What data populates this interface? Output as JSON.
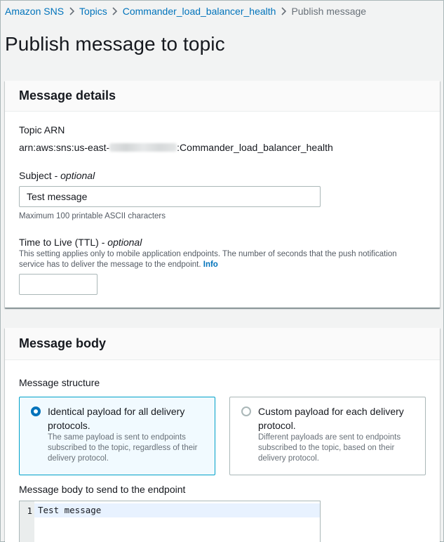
{
  "breadcrumb": {
    "items": [
      "Amazon SNS",
      "Topics",
      "Commander_load_balancer_health"
    ],
    "current": "Publish message"
  },
  "page_title": "Publish message to topic",
  "message_details": {
    "header": "Message details",
    "topic_arn_label": "Topic ARN",
    "topic_arn_prefix": "arn:aws:sns:us-east-",
    "topic_arn_suffix": ":Commander_load_balancer_health",
    "subject_label": "Subject - ",
    "subject_optional": "optional",
    "subject_value": "Test message",
    "subject_hint": "Maximum 100 printable ASCII characters",
    "ttl_label": "Time to Live (TTL) - ",
    "ttl_optional": "optional",
    "ttl_desc": "This setting applies only to mobile application endpoints. The number of seconds that the push notification service has to deliver the message to the endpoint.",
    "ttl_info": "Info",
    "ttl_value": ""
  },
  "message_body": {
    "header": "Message body",
    "structure_label": "Message structure",
    "options": [
      {
        "title": "Identical payload for all delivery protocols.",
        "desc": "The same payload is sent to endpoints subscribed to the topic, regardless of their delivery protocol.",
        "selected": true
      },
      {
        "title": "Custom payload for each delivery protocol.",
        "desc": "Different payloads are sent to endpoints subscribed to the topic, based on their delivery protocol.",
        "selected": false
      }
    ],
    "body_label": "Message body to send to the endpoint",
    "editor_line_number": "1",
    "editor_text": "Test message"
  },
  "colors": {
    "link": "#0073bb",
    "selected_border": "#00a1c9",
    "selected_bg": "#f1faff",
    "page_bg": "#f2f3f3"
  },
  "icons": [
    "chevron-right-icon"
  ]
}
